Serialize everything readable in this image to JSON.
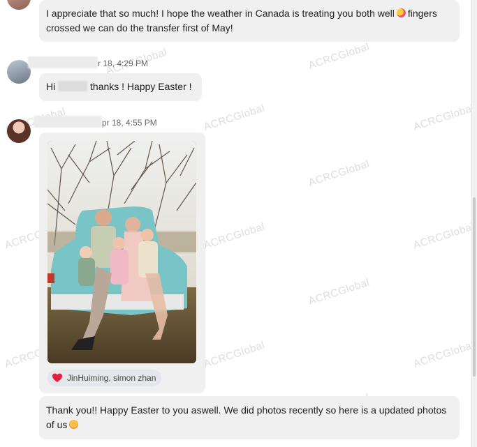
{
  "messages": [
    {
      "text_line1": "I appreciate that so much! I hope the weather in Canada is treating you both well",
      "text_line1_tail": "fingers",
      "text_line2": "crossed we can do the transfer first of May!"
    },
    {
      "time": "r 18, 4:29 PM",
      "text_prefix": "Hi",
      "text_suffix": "thanks ! Happy Easter !"
    },
    {
      "time": "pr 18, 4:55 PM",
      "photo_alt": "family photo",
      "reactions_label": "JinHuiming, simon zhan"
    },
    {
      "text_line1": "Thank you!! Happy Easter to you aswell. We did photos recently so here is a updated photos",
      "text_line2": "of us"
    }
  ],
  "watermark": "ACRCGlobal",
  "icons": {
    "emoji_1": "hugging-face-emoji",
    "emoji_2": "blushing-face-emoji",
    "reaction": "heart-icon"
  },
  "colors": {
    "bubble": "#f0f0f0",
    "heart": "#e41e3f"
  }
}
